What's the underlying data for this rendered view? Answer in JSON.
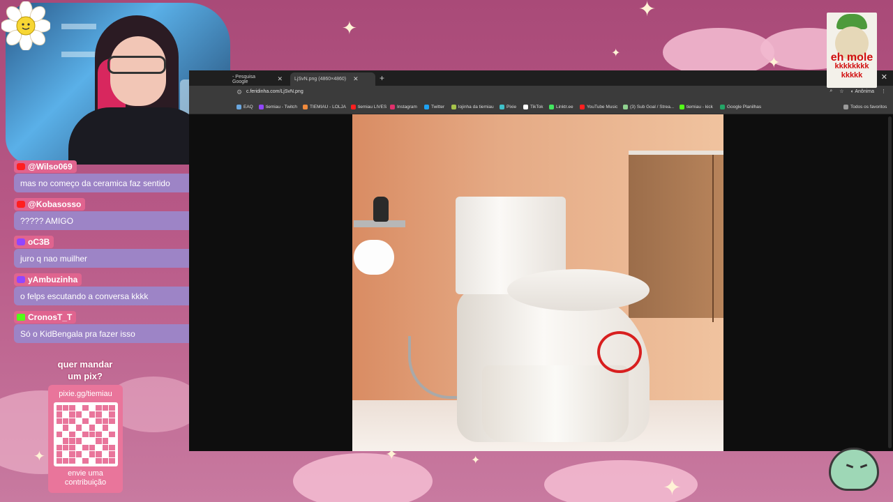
{
  "webcam": {
    "alt": "streamer webcam"
  },
  "chat": [
    {
      "platform": "youtube",
      "user": "@Wilso069",
      "text": "mas no começo da ceramica faz sentido"
    },
    {
      "platform": "youtube",
      "user": "@Kobasosso",
      "text": "????? AMIGO"
    },
    {
      "platform": "twitch",
      "user": "oC3B",
      "text": "juro q nao muilher"
    },
    {
      "platform": "twitch",
      "user": "yAmbuzinha",
      "text": "o felps escutando a conversa kkkk"
    },
    {
      "platform": "kick",
      "user": "CronosT_T",
      "text": "Só o KidBengala pra fazer isso"
    }
  ],
  "pix": {
    "title_line1": "quer mandar",
    "title_line2": "um pix?",
    "link": "pixie.gg/tiemiau",
    "cta_line1": "envie uma",
    "cta_line2": "contribuição"
  },
  "browser": {
    "tabs": [
      {
        "label": "- Pesquisa Google",
        "active": false
      },
      {
        "label": "LjSvN.png (4860×4860)",
        "active": true
      }
    ],
    "new_tab": "+",
    "close_window": "✕",
    "url": "c.feridinha.com/LjSvN.png",
    "profile": "Anônima",
    "bookmarks": [
      {
        "label": "EAQ",
        "color": "#6aa7e0"
      },
      {
        "label": "tiemiau - Twitch",
        "color": "#9146ff"
      },
      {
        "label": "TIEMIAU - LOLJA",
        "color": "#f08a3c"
      },
      {
        "label": "tiemiau LIVES",
        "color": "#ff1f1f"
      },
      {
        "label": "Instagram",
        "color": "#e1306c"
      },
      {
        "label": "Twitter",
        "color": "#1da1f2"
      },
      {
        "label": "lojinha da tiemiau",
        "color": "#a6c34a"
      },
      {
        "label": "Pixie",
        "color": "#3fc1c9"
      },
      {
        "label": "TikTok",
        "color": "#ffffff"
      },
      {
        "label": "Linktr.ee",
        "color": "#43e660"
      },
      {
        "label": "YouTube Music",
        "color": "#ff1f1f"
      },
      {
        "label": "(3) Sub Goal / Strea...",
        "color": "#8fd18f"
      },
      {
        "label": "tiemiau - kick",
        "color": "#53fc18"
      },
      {
        "label": "Google Planilhas",
        "color": "#23a566"
      }
    ],
    "all_bookmarks": "Todos os favoritos"
  },
  "overlay": {
    "meme_line1": "eh mole",
    "meme_line2": "kkkkkkkk",
    "meme_line3": "kkkkk"
  },
  "colors": {
    "chat_user_bg": "#e0648f",
    "chat_text_bg": "#9d84c6",
    "highlight_circle": "#d81f1f"
  }
}
